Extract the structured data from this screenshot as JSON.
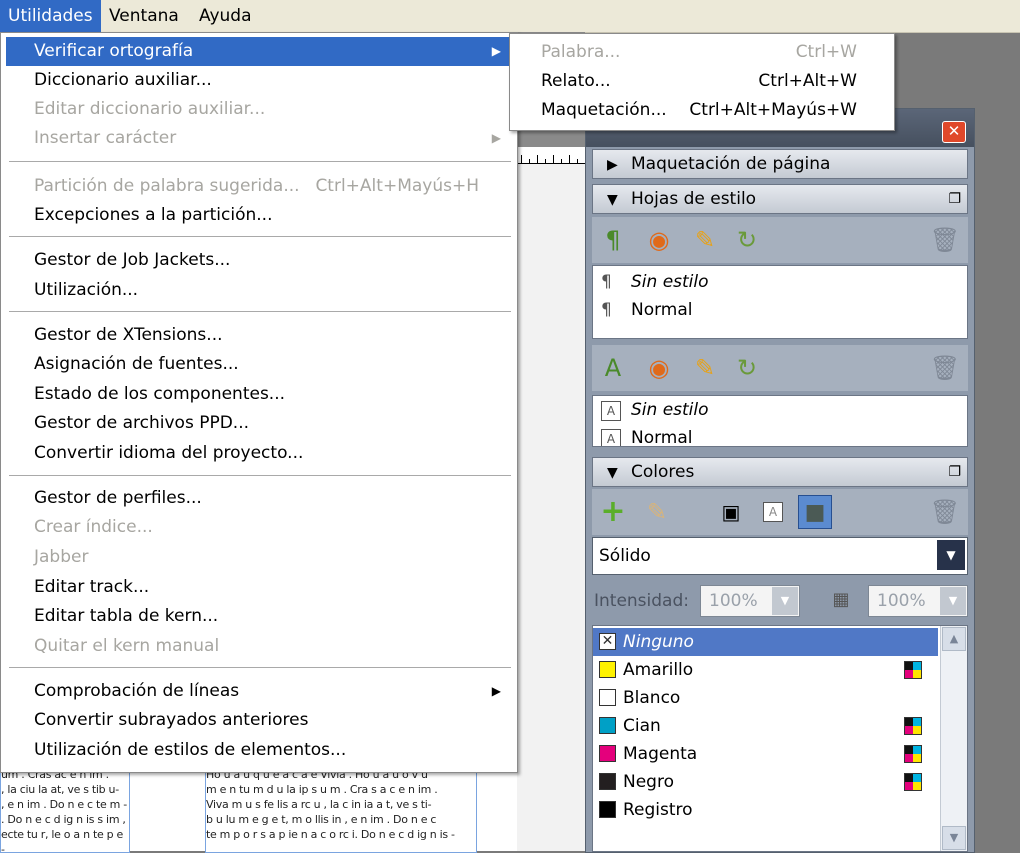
{
  "menubar": {
    "items": [
      "Utilidades",
      "Ventana",
      "Ayuda"
    ],
    "active": "Utilidades"
  },
  "menu": {
    "items": [
      {
        "label": "Verificar ortografía",
        "submenu": true,
        "highlighted": true
      },
      {
        "label": "Diccionario auxiliar..."
      },
      {
        "label": "Editar diccionario auxiliar...",
        "disabled": true
      },
      {
        "label": "Insertar carácter",
        "submenu": true,
        "disabled": true
      },
      {
        "label": "Partición de palabra sugerida...",
        "shortcut": "Ctrl+Alt+Mayús+H",
        "disabled": true
      },
      {
        "label": "Excepciones a la partición..."
      },
      {
        "label": "Gestor de Job Jackets..."
      },
      {
        "label": "Utilización..."
      },
      {
        "label": "Gestor de XTensions..."
      },
      {
        "label": "Asignación de fuentes..."
      },
      {
        "label": "Estado de los componentes..."
      },
      {
        "label": "Gestor de archivos PPD..."
      },
      {
        "label": "Convertir idioma del proyecto..."
      },
      {
        "label": "Gestor de perfiles..."
      },
      {
        "label": "Crear índice...",
        "disabled": true
      },
      {
        "label": "Jabber",
        "disabled": true
      },
      {
        "label": "Editar track..."
      },
      {
        "label": "Editar tabla de kern..."
      },
      {
        "label": "Quitar el kern manual",
        "disabled": true
      },
      {
        "label": "Comprobación de líneas",
        "submenu": true
      },
      {
        "label": "Convertir subrayados anteriores"
      },
      {
        "label": "Utilización de estilos de elementos..."
      }
    ]
  },
  "submenu": {
    "items": [
      {
        "label": "Palabra...",
        "shortcut": "Ctrl+W",
        "disabled": true
      },
      {
        "label": "Relato...",
        "shortcut": "Ctrl+Alt+W"
      },
      {
        "label": "Maquetación...",
        "shortcut": "Ctrl+Alt+Mayús+W"
      }
    ]
  },
  "palette": {
    "close_glyph": "✕",
    "sections": {
      "layout": "Maquetación de página",
      "styles": "Hojas de estilo",
      "colors": "Colores"
    },
    "paragraph_styles": [
      "Sin estilo",
      "Normal"
    ],
    "character_styles": [
      "Sin estilo",
      "Normal"
    ],
    "fill_type": "Sólido",
    "intensity_label": "Intensidad:",
    "intensity_value": "100%",
    "intensity_value2": "100%",
    "colors": [
      {
        "name": "Ninguno",
        "swatch": "#ffffff",
        "cmyk": false,
        "selected": true
      },
      {
        "name": "Amarillo",
        "swatch": "#fff200",
        "cmyk": true
      },
      {
        "name": "Blanco",
        "swatch": "#ffffff",
        "cmyk": false
      },
      {
        "name": "Cian",
        "swatch": "#00a0c6",
        "cmyk": true
      },
      {
        "name": "Magenta",
        "swatch": "#e4007c",
        "cmyk": true
      },
      {
        "name": "Negro",
        "swatch": "#231f20",
        "cmyk": true
      },
      {
        "name": "Registro",
        "swatch": "#000000",
        "cmyk": false
      }
    ]
  },
  "document": {
    "frame_left": [
      "um . Cras ac e n im .",
      ", la ciu la at, ve s tib u-",
      ", e n im . Do n e c te m -",
      ". Do n e c d ig n is s im ,",
      "ecte tu r, le o a n te p e -"
    ],
    "frame_center": [
      "Ho u a u q u e a c a e Vivia . Ho u a u o v u",
      "m e n tu m d u la ip s u m . Cra s a c e n im .",
      "Viva m u s fe lis a rc u , la c in ia a t, ve s ti-",
      "b u lu m e g e t, m o llis in , e n im . Do n e c",
      "te m p o r s a p ie n a c o rc i. Do n e c d ig n is -"
    ]
  }
}
